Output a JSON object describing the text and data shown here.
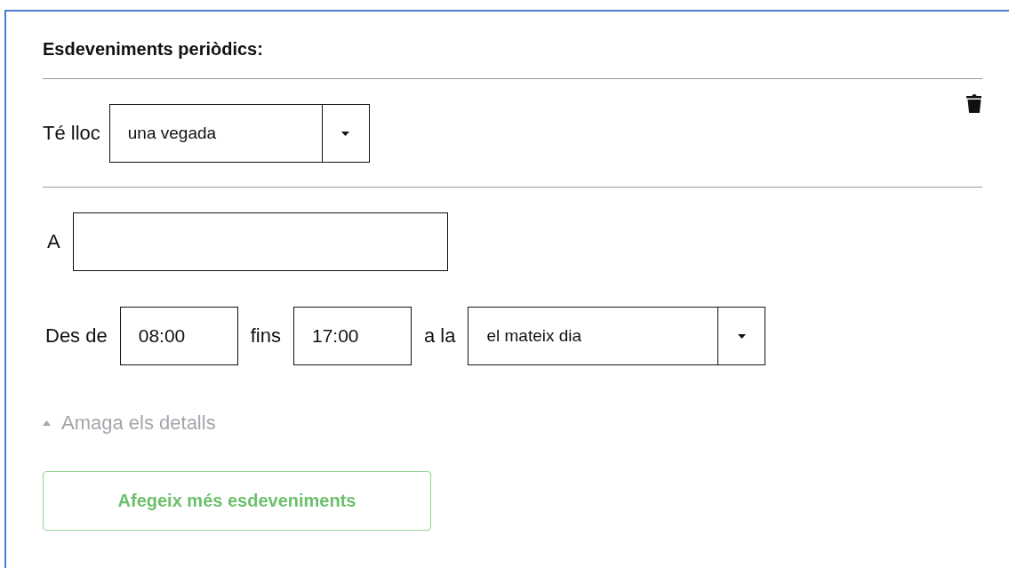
{
  "section": {
    "title": "Esdeveniments periòdics:"
  },
  "occurrence": {
    "label": "Té lloc",
    "value": "una vegada"
  },
  "at": {
    "label": "A"
  },
  "time": {
    "from_label": "Des de",
    "from": "08:00",
    "to_label": "fins",
    "to": "17:00",
    "day_label": "a la",
    "day": "el mateix dia"
  },
  "details_toggle": {
    "label": "Amaga els detalls",
    "expanded": true
  },
  "add_button": {
    "label": "Afegeix més esdeveniments"
  }
}
